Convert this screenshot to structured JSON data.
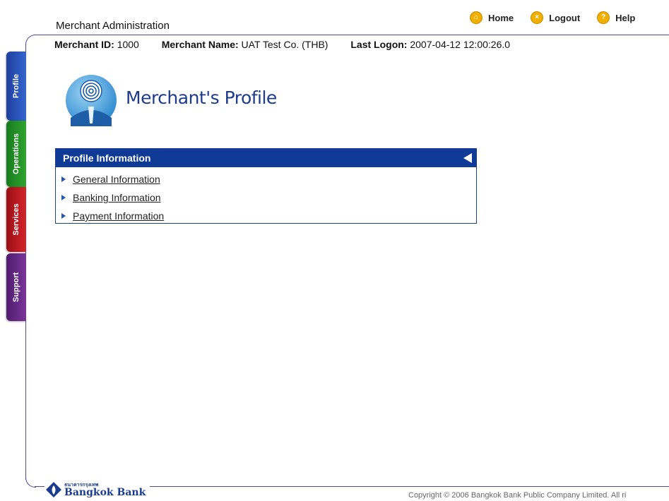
{
  "header": {
    "app_title": "Merchant Administration",
    "links": [
      {
        "label": "Home",
        "icon": "home-icon",
        "glyph": "⌂"
      },
      {
        "label": "Logout",
        "icon": "logout-icon",
        "glyph": "×"
      },
      {
        "label": "Help",
        "icon": "help-icon",
        "glyph": "?"
      }
    ]
  },
  "merchant_info": {
    "id_label": "Merchant ID:",
    "id_value": "1000",
    "name_label": "Merchant Name:",
    "name_value": "UAT Test Co. (THB)",
    "logon_label": "Last Logon:",
    "logon_value": "2007-04-12 12:00:26.0"
  },
  "side_tabs": [
    "Profile",
    "Operations",
    "Services",
    "Support"
  ],
  "page": {
    "title": "Merchant's Profile"
  },
  "profile_panel": {
    "title": "Profile Information",
    "items": [
      "General Information",
      "Banking Information",
      "Payment Information"
    ]
  },
  "footer": {
    "bank_name_thai": "ธนาคารกรุงเทพ",
    "bank_name": "Bangkok Bank",
    "copyright": "Copyright © 2006 Bangkok Bank Public Company Limited. All ri"
  },
  "colors": {
    "accent": "#0f3b96",
    "tab_profile": "#2a55c0",
    "tab_operations": "#24922a",
    "tab_services": "#c01c22",
    "tab_support": "#6a2c8a",
    "icon_orange": "#f0b000"
  }
}
